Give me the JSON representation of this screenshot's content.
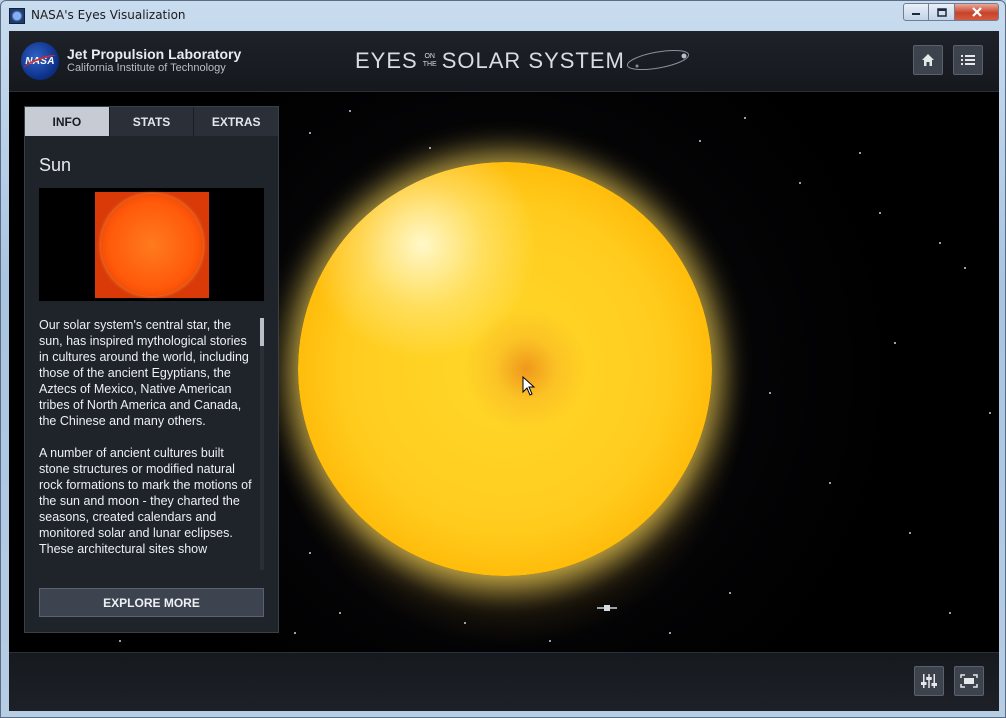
{
  "window": {
    "title": "NASA's Eyes Visualization",
    "icon": "app-icon",
    "controls": [
      "minimize-icon",
      "maximize-icon",
      "close-icon"
    ]
  },
  "header": {
    "lab_name": "Jet Propulsion Laboratory",
    "lab_sub": "California Institute of Technology",
    "title_left": "EYES",
    "title_on": "ON",
    "title_the": "THE",
    "title_right": "SOLAR SYSTEM",
    "logo_text": "NASA",
    "buttons": [
      "home-icon",
      "list-icon"
    ]
  },
  "panel": {
    "tabs": [
      {
        "label": "INFO",
        "active": true
      },
      {
        "label": "STATS",
        "active": false
      },
      {
        "label": "EXTRAS",
        "active": false
      }
    ],
    "title": "Sun",
    "paragraphs": [
      "Our solar system's central star, the sun, has inspired mythological stories in cultures around the world, including those of the ancient Egyptians, the Aztecs of Mexico, Native American tribes of North America and Canada, the Chinese and many others.",
      "A number of ancient cultures built stone structures or modified natural rock formations to mark the motions of the sun and moon - they charted the seasons, created calendars and monitored solar and lunar eclipses. These architectural sites show"
    ],
    "explore_label": "EXPLORE MORE"
  },
  "footer": {
    "buttons": [
      "sliders-icon",
      "fullscreen-icon"
    ]
  },
  "colors": {
    "panel_bg": "#1f232a",
    "tab_active": "#c7ccd4",
    "sun": "#ffcc1e"
  }
}
